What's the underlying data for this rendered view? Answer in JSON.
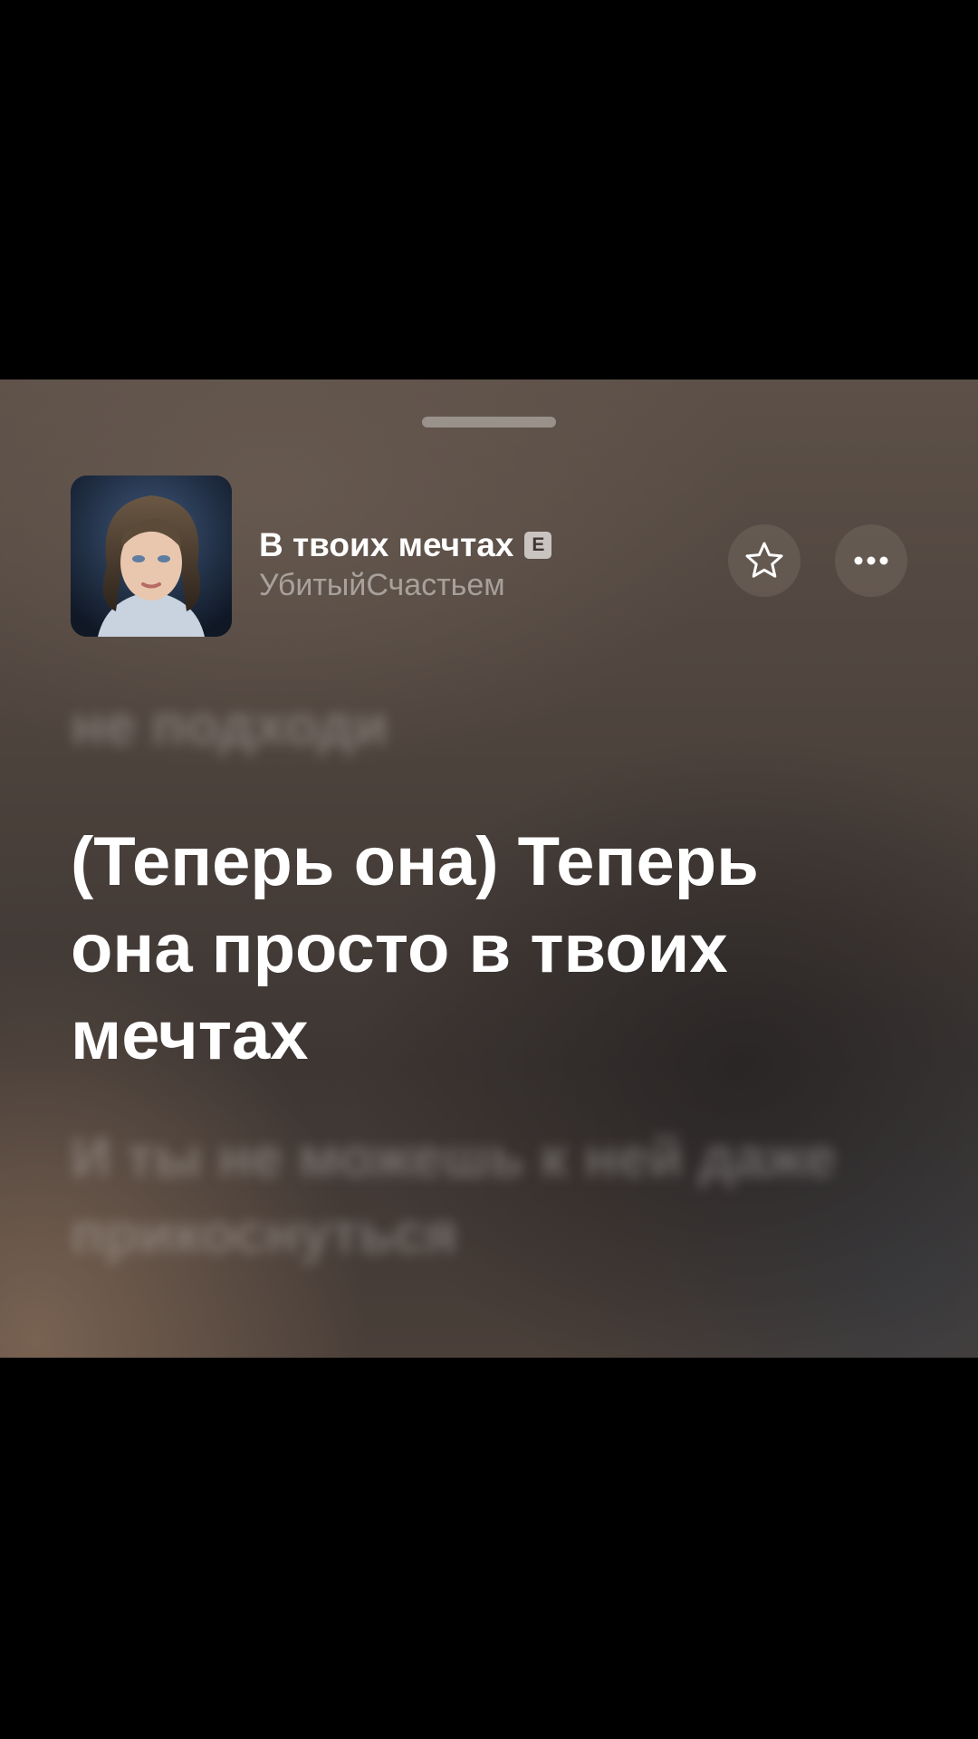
{
  "sheet": {
    "handle_icon": "grabber-handle"
  },
  "track": {
    "title": "В твоих мечтах",
    "explicit_badge": "E",
    "artist": "УбитыйСчастьем",
    "cover_icon": "album-cover-portrait"
  },
  "actions": {
    "favorite_icon": "star-outline-icon",
    "more_icon": "ellipsis-icon"
  },
  "lyrics": {
    "previous": "не подходи",
    "current": "(Теперь она) Теперь она просто в твоих мечтах",
    "next": "И ты не можешь к ней даже прикоснуться"
  },
  "colors": {
    "background": "#4c423c",
    "text_primary": "#ffffff",
    "text_secondary": "#8f8883"
  }
}
